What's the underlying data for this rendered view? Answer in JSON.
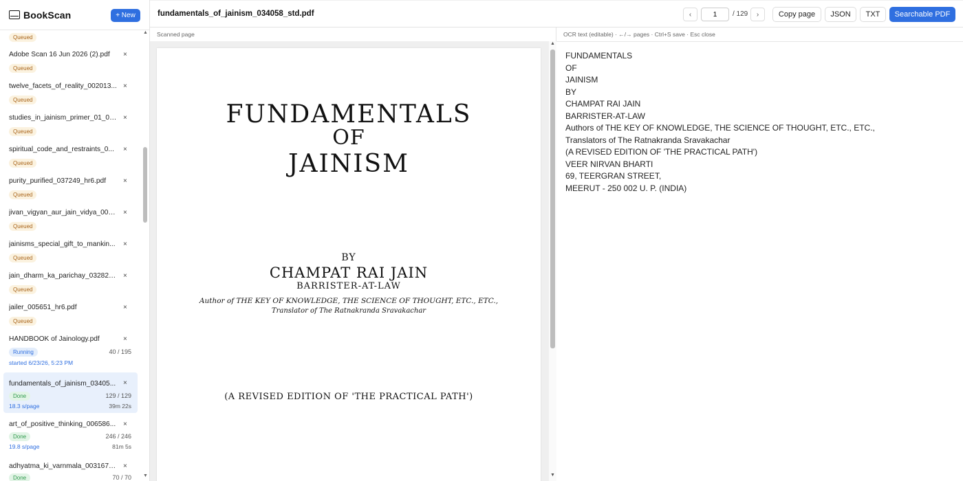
{
  "app": {
    "name": "BookScan",
    "new_label": "+ New"
  },
  "sidebar": {
    "items": [
      {
        "name": "",
        "status": "Queued"
      },
      {
        "name": "Adobe Scan 16 Jun 2026 (2).pdf",
        "status": "Queued"
      },
      {
        "name": "twelve_facets_of_reality_002013...",
        "status": "Queued"
      },
      {
        "name": "studies_in_jainism_primer_01_03...",
        "status": "Queued"
      },
      {
        "name": "spiritual_code_and_restraints_0...",
        "status": "Queued"
      },
      {
        "name": "purity_purified_037249_hr6.pdf",
        "status": "Queued"
      },
      {
        "name": "jivan_vigyan_aur_jain_vidya_003...",
        "status": "Queued"
      },
      {
        "name": "jainisms_special_gift_to_mankin...",
        "status": "Queued"
      },
      {
        "name": "jain_dharm_ka_parichay_032824...",
        "status": "Queued"
      },
      {
        "name": "jailer_005651_hr6.pdf",
        "status": "Queued"
      },
      {
        "name": "HANDBOOK of Jainology.pdf",
        "status": "Running",
        "count": "40 / 195",
        "meta": "started 6/23/26, 5:23 PM",
        "meta_right": ""
      },
      {
        "name": "fundamentals_of_jainism_03405...",
        "status": "Done",
        "count": "129 / 129",
        "meta": "18.3 s/page",
        "meta_right": "39m 22s"
      },
      {
        "name": "art_of_positive_thinking_006586...",
        "status": "Done",
        "count": "246 / 246",
        "meta": "19.8 s/page",
        "meta_right": "81m 5s"
      },
      {
        "name": "adhyatma_ki_varnmala_003167_...",
        "status": "Done",
        "count": "70 / 70"
      }
    ]
  },
  "toolbar": {
    "filename": "fundamentals_of_jainism_034058_std.pdf",
    "prev": "‹",
    "next": "›",
    "page": "1",
    "total": "/ 129",
    "copy_page": "Copy page",
    "json": "JSON",
    "txt": "TXT",
    "searchable_pdf": "Searchable PDF"
  },
  "scan": {
    "label": "Scanned page",
    "title1": "FUNDAMENTALS",
    "title2": "OF",
    "title3": "JAINISM",
    "by": "BY",
    "author": "CHAMPAT RAI JAIN",
    "barrister": "BARRISTER-AT-LAW",
    "authors_line": "Author of THE KEY OF KNOWLEDGE, THE SCIENCE OF THOUGHT, ETC., ETC.,",
    "translator_line": "Translator of The Ratnakranda Sravakachar",
    "revised": "(A REVISED EDITION OF 'THE PRACTICAL PATH')"
  },
  "ocr": {
    "label": "OCR text (editable) · ←/→ pages · Ctrl+S save · Esc close",
    "lines": [
      "FUNDAMENTALS",
      "OF",
      "JAINISM",
      "BY",
      "CHAMPAT RAI JAIN",
      "BARRISTER-AT-LAW",
      "Authors of THE KEY OF KNOWLEDGE, THE SCIENCE OF THOUGHT, ETC., ETC.,",
      "Translators of The Ratnakranda Sravakachar",
      "(A REVISED EDITION OF 'THE PRACTICAL PATH')",
      "VEER NIRVAN BHARTI",
      "69, TEERGRAN STREET,",
      "MEERUT - 250 002 U. P. (INDIA)"
    ]
  },
  "colors": {
    "accent": "#2f6fe0",
    "queued": "#a8641a",
    "done": "#2f9a4c",
    "selected_bg": "#e8f0fc"
  }
}
